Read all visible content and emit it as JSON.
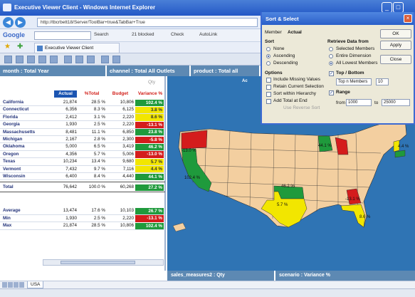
{
  "window": {
    "title": "Executive Viewer Client - Windows Internet Explorer"
  },
  "browser": {
    "url": "http://tbcrbett18/Server/ToolBar+true&TabBar+True",
    "google_label": "Google",
    "search_label": "Search",
    "blocked_label": "21 blocked",
    "check_label": "Check",
    "autolink_label": "AutoLink",
    "tab_title": "Executive Viewer Client"
  },
  "dimensions": {
    "month": "month : Total Year",
    "channel": "channel : Total All Outlets",
    "product": "product : Total all",
    "map_partial": "Ac"
  },
  "grid": {
    "unit": "Qty",
    "columns": [
      "Actual",
      "%Total",
      "Budget",
      "Variance %"
    ],
    "rows": [
      {
        "name": "California",
        "actual": "21,874",
        "pct": "28.5 %",
        "budget": "10,806",
        "variance": "102.4 %",
        "vcolor": "#1f9a3c"
      },
      {
        "name": "Connecticut",
        "actual": "6,356",
        "pct": "8.3 %",
        "budget": "6,125",
        "variance": "3.8 %",
        "vcolor": "#f2e600"
      },
      {
        "name": "Florida",
        "actual": "2,412",
        "pct": "3.1 %",
        "budget": "2,220",
        "variance": "8.6 %",
        "vcolor": "#f2e600"
      },
      {
        "name": "Georgia",
        "actual": "1,930",
        "pct": "2.5 %",
        "budget": "2,220",
        "variance": "-13.1 %",
        "vcolor": "#d41c1c"
      },
      {
        "name": "Massachusetts",
        "actual": "8,481",
        "pct": "11.1 %",
        "budget": "6,850",
        "variance": "23.8 %",
        "vcolor": "#1f9a3c"
      },
      {
        "name": "Michigan",
        "actual": "2,167",
        "pct": "2.8 %",
        "budget": "2,300",
        "variance": "-5.8 %",
        "vcolor": "#d41c1c"
      },
      {
        "name": "Oklahoma",
        "actual": "5,000",
        "pct": "6.5 %",
        "budget": "3,419",
        "variance": "46.2 %",
        "vcolor": "#1f9a3c"
      },
      {
        "name": "Oregon",
        "actual": "4,356",
        "pct": "5.7 %",
        "budget": "5,006",
        "variance": "-13.0 %",
        "vcolor": "#d41c1c"
      },
      {
        "name": "Texas",
        "actual": "10,234",
        "pct": "13.4 %",
        "budget": "9,680",
        "variance": "5.7 %",
        "vcolor": "#f2e600"
      },
      {
        "name": "Vermont",
        "actual": "7,432",
        "pct": "9.7 %",
        "budget": "7,116",
        "variance": "4.4 %",
        "vcolor": "#f2e600"
      },
      {
        "name": "Wisconsin",
        "actual": "6,400",
        "pct": "8.4 %",
        "budget": "4,440",
        "variance": "44.1 %",
        "vcolor": "#1f9a3c"
      }
    ],
    "total": {
      "name": "Total",
      "actual": "76,642",
      "pct": "100.0 %",
      "budget": "60,268",
      "variance": "27.2 %",
      "vcolor": "#1f9a3c"
    },
    "stats": [
      {
        "name": "Average",
        "actual": "13,474",
        "pct": "17.6 %",
        "budget": "10,103",
        "variance": "26.7 %",
        "vcolor": "#1f9a3c"
      },
      {
        "name": "Min",
        "actual": "1,930",
        "pct": "2.5 %",
        "budget": "2,220",
        "variance": "-13.1 %",
        "vcolor": "#d41c1c"
      },
      {
        "name": "Max",
        "actual": "21,874",
        "pct": "28.5 %",
        "budget": "10,806",
        "variance": "102.4 %",
        "vcolor": "#1f9a3c"
      }
    ]
  },
  "map": {
    "labels": {
      "oregon": "-13.0 %",
      "california": "102.4 %",
      "oklahoma": "46.2 %",
      "texas": "5.7 %",
      "wisconsin": "44.1 %",
      "georgia": "-13.1 %",
      "florida": "8.6 %",
      "vermont": "4.4 %"
    },
    "colors": {
      "ocean": "#2f74b4",
      "land": "#f3cfa0",
      "green": "#1f9a3c",
      "red": "#d41c1c",
      "yellow": "#f2e600"
    }
  },
  "footer": {
    "measure": "sales_measures2 : Qty",
    "scenario": "scenario : Variance %"
  },
  "sheet_tab": "USA",
  "dialog": {
    "title": "Sort & Select",
    "member_label": "Member",
    "member_value": "Actual",
    "sort_heading": "Sort",
    "sort_options": [
      "None",
      "Ascending",
      "Descending"
    ],
    "sort_selected": "Ascending",
    "retrieve_heading": "Retrieve Data from",
    "retrieve_options": [
      "Selected Members",
      "Entire Dimension",
      "All Lowest Members"
    ],
    "retrieve_selected": "All Lowest Members",
    "options_heading": "Options",
    "options": [
      "Include Missing Values",
      "Retain Current Selection",
      "Sort within Hierarchy",
      "Add Total at End"
    ],
    "remove_text": "Use Reverse Sort",
    "topbottom_label": "Top / Bottom",
    "topbottom_value": "Top n Members",
    "topbottom_n": "10",
    "range_label": "Range",
    "from_label": "from",
    "from_value": "1000",
    "to_label": "to",
    "to_value": "25000",
    "ok": "OK",
    "apply": "Apply",
    "close": "Close"
  }
}
